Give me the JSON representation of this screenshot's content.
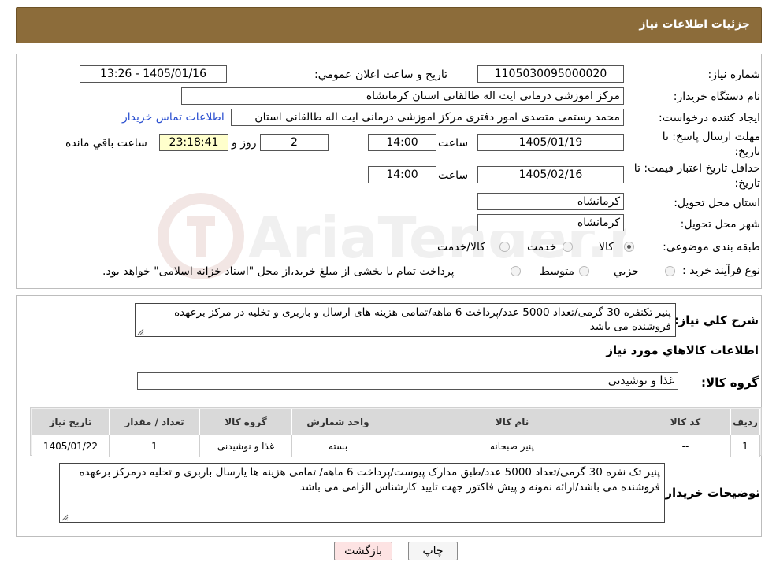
{
  "header": {
    "title": "جزئیات اطلاعات نیاز"
  },
  "watermark": {
    "text": "AriaTender.neT"
  },
  "form": {
    "need_number_label": "شماره نیاز:",
    "need_number": "1105030095000020",
    "announce_label": "تاریخ و ساعت اعلان عمومي:",
    "announce_value": "1405/01/16 - 13:26",
    "buyer_org_label": "نام دستگاه خریدار:",
    "buyer_org": "مرکز اموزشی درمانی ایت اله طالقانی استان کرمانشاه",
    "creator_label": "ایجاد کننده درخواست:",
    "creator": "محمد رستمی متصدی امور دفتری مرکز اموزشی درمانی ایت اله طالقانی استان",
    "contact_link": "اطلاعات تماس خریدار",
    "deadline_label_line1": "مهلت ارسال پاسخ: تا",
    "deadline_label_line2": "تاریخ:",
    "deadline_date": "1405/01/19",
    "time_label": "ساعت",
    "deadline_time": "14:00",
    "days_value": "2",
    "days_label": "روز و",
    "remaining_time": "23:18:41",
    "remaining_label": "ساعت باقي مانده",
    "validity_label_line1": "حداقل تاریخ اعتبار قیمت: تا",
    "validity_label_line2": "تاریخ:",
    "validity_date": "1405/02/16",
    "validity_time": "14:00",
    "province_label": "استان محل تحویل:",
    "province": "کرمانشاه",
    "city_label": "شهر محل تحویل:",
    "city": "کرمانشاه",
    "category_label": "طبقه بندی موضوعی:",
    "category_options": [
      "کالا",
      "خدمت",
      "کالا/خدمت"
    ],
    "category_selected": "کالا",
    "process_label": "نوع فرآیند خرید :",
    "process_options": [
      "جزيي",
      "متوسط"
    ],
    "process_note": "پرداخت تمام یا بخشی از مبلغ خرید،از محل \"اسناد خزانه اسلامی\" خواهد بود."
  },
  "summary": {
    "label": "شرح کلي نياز:",
    "text": "پنیر تکنفره 30 گرمی/تعداد 5000 عدد/پرداخت 6 ماهه/تمامی هزینه های ارسال و باربری و تخلیه در مرکز برعهده فروشنده می باشد"
  },
  "goods": {
    "section_title": "اطلاعات کالاهاي مورد نياز",
    "group_label": "گروه کالا:",
    "group_value": "غذا و نوشیدنی",
    "table": {
      "headers": [
        "رديف",
        "کد کالا",
        "نام کالا",
        "واحد شمارش",
        "گروه کالا",
        "تعداد / مقدار",
        "تاریخ نیاز"
      ],
      "rows": [
        [
          "1",
          "--",
          "پنیر صبحانه",
          "بسته",
          "غذا و نوشیدنی",
          "1",
          "1405/01/22"
        ]
      ]
    }
  },
  "buyer_notes": {
    "label": "توضیحات خریدار:",
    "text": "پنیر تک نفره 30 گرمی/تعداد 5000 عدد/طبق مدارک پیوست/پرداخت 6 ماهه/ تمامی هزینه ها یارسال باربری و تخلیه درمرکز برعهده فروشنده می باشد/ارائه نمونه و پیش فاکتور جهت تایید کارشناس الزامی می باشد"
  },
  "buttons": {
    "print": "چاپ",
    "back": "بازگشت"
  },
  "colors": {
    "title_bg": "#8c6c3a",
    "link": "#2a4fd0",
    "timer_bg": "#ffffcc",
    "back_bg": "#fde3e3",
    "table_header": "#d9d9d9"
  }
}
